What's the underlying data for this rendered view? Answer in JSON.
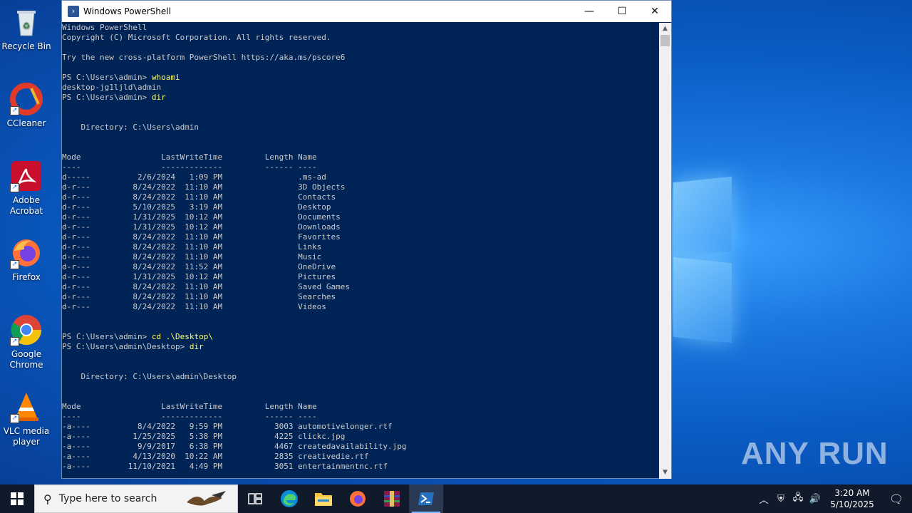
{
  "window": {
    "title": "Windows PowerShell",
    "controls": {
      "minimize": "—",
      "maximize": "☐",
      "close": "✕"
    }
  },
  "console": {
    "lines": [
      {
        "t": "Windows PowerShell"
      },
      {
        "t": "Copyright (C) Microsoft Corporation. All rights reserved."
      },
      {
        "t": ""
      },
      {
        "t": "Try the new cross-platform PowerShell https://aka.ms/pscore6"
      },
      {
        "t": ""
      },
      {
        "t": "PS C:\\Users\\admin> ",
        "cmd": "whoami"
      },
      {
        "t": "desktop-jg1ljld\\admin"
      },
      {
        "t": "PS C:\\Users\\admin> ",
        "cmd": "dir"
      },
      {
        "t": ""
      },
      {
        "t": ""
      },
      {
        "t": "    Directory: C:\\Users\\admin"
      },
      {
        "t": ""
      },
      {
        "t": ""
      },
      {
        "t": "Mode                 LastWriteTime         Length Name"
      },
      {
        "t": "----                 -------------         ------ ----"
      },
      {
        "t": "d-----          2/6/2024   1:09 PM                .ms-ad"
      },
      {
        "t": "d-r---         8/24/2022  11:10 AM                3D Objects"
      },
      {
        "t": "d-r---         8/24/2022  11:10 AM                Contacts"
      },
      {
        "t": "d-r---         5/10/2025   3:19 AM                Desktop"
      },
      {
        "t": "d-r---         1/31/2025  10:12 AM                Documents"
      },
      {
        "t": "d-r---         1/31/2025  10:12 AM                Downloads"
      },
      {
        "t": "d-r---         8/24/2022  11:10 AM                Favorites"
      },
      {
        "t": "d-r---         8/24/2022  11:10 AM                Links"
      },
      {
        "t": "d-r---         8/24/2022  11:10 AM                Music"
      },
      {
        "t": "d-r---         8/24/2022  11:52 AM                OneDrive"
      },
      {
        "t": "d-r---         1/31/2025  10:12 AM                Pictures"
      },
      {
        "t": "d-r---         8/24/2022  11:10 AM                Saved Games"
      },
      {
        "t": "d-r---         8/24/2022  11:10 AM                Searches"
      },
      {
        "t": "d-r---         8/24/2022  11:10 AM                Videos"
      },
      {
        "t": ""
      },
      {
        "t": ""
      },
      {
        "t": "PS C:\\Users\\admin> ",
        "cmd": "cd .\\Desktop\\"
      },
      {
        "t": "PS C:\\Users\\admin\\Desktop> ",
        "cmd": "dir"
      },
      {
        "t": ""
      },
      {
        "t": ""
      },
      {
        "t": "    Directory: C:\\Users\\admin\\Desktop"
      },
      {
        "t": ""
      },
      {
        "t": ""
      },
      {
        "t": "Mode                 LastWriteTime         Length Name"
      },
      {
        "t": "----                 -------------         ------ ----"
      },
      {
        "t": "-a----          8/4/2022   9:59 PM           3003 automotivelonger.rtf"
      },
      {
        "t": "-a----         1/25/2025   5:38 PM           4225 clickc.jpg"
      },
      {
        "t": "-a----          9/9/2017   6:38 PM           4467 createdavailability.jpg"
      },
      {
        "t": "-a----         4/13/2020  10:22 AM           2835 creativedie.rtf"
      },
      {
        "t": "-a----        11/10/2021   4:49 PM           3051 entertainmentnc.rtf"
      }
    ]
  },
  "desktop_icons": [
    {
      "label": "Recycle Bin",
      "icon": "recycle-bin-icon"
    },
    {
      "label": "CCleaner",
      "icon": "ccleaner-icon"
    },
    {
      "label": "Adobe Acrobat",
      "icon": "acrobat-icon"
    },
    {
      "label": "Firefox",
      "icon": "firefox-icon"
    },
    {
      "label": "Google Chrome",
      "icon": "chrome-icon"
    },
    {
      "label": "VLC media player",
      "icon": "vlc-icon"
    }
  ],
  "watermark": "ANY RUN",
  "taskbar": {
    "search_placeholder": "Type here to search",
    "clock_time": "3:20 AM",
    "clock_date": "5/10/2025"
  },
  "colors": {
    "console_bg": "#012456",
    "console_text": "#cccccc",
    "command_text": "#ffff66"
  }
}
